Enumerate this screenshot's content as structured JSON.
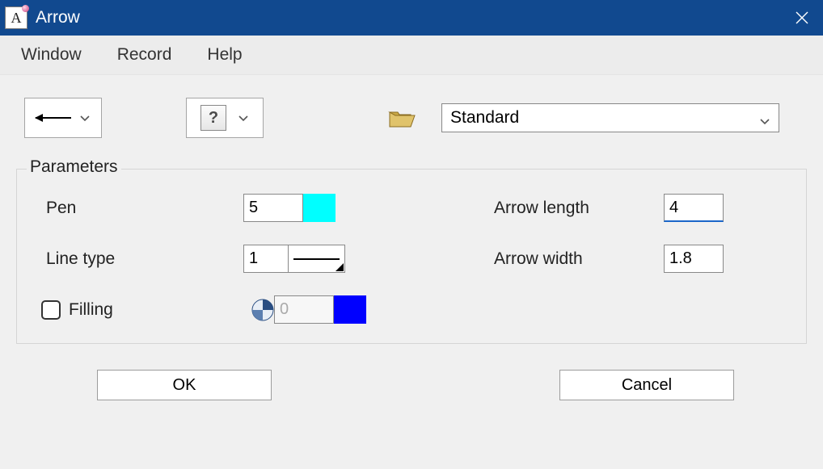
{
  "title": "Arrow",
  "menubar": {
    "window": "Window",
    "record": "Record",
    "help": "Help"
  },
  "toolbar": {
    "arrow_tool_name": "arrow-left",
    "help_glyph": "?",
    "preset_label": "Standard"
  },
  "group": {
    "title": "Parameters"
  },
  "params": {
    "pen_label": "Pen",
    "pen_value": "5",
    "pen_color": "#00ffff",
    "linetype_label": "Line type",
    "linetype_value": "1",
    "filling_label": "Filling",
    "filling_checked": false,
    "filling_value": "0",
    "filling_color": "#0000ff",
    "arrowlen_label": "Arrow length",
    "arrowlen_value": "4",
    "arrowwidth_label": "Arrow width",
    "arrowwidth_value": "1.8"
  },
  "buttons": {
    "ok": "OK",
    "cancel": "Cancel"
  }
}
